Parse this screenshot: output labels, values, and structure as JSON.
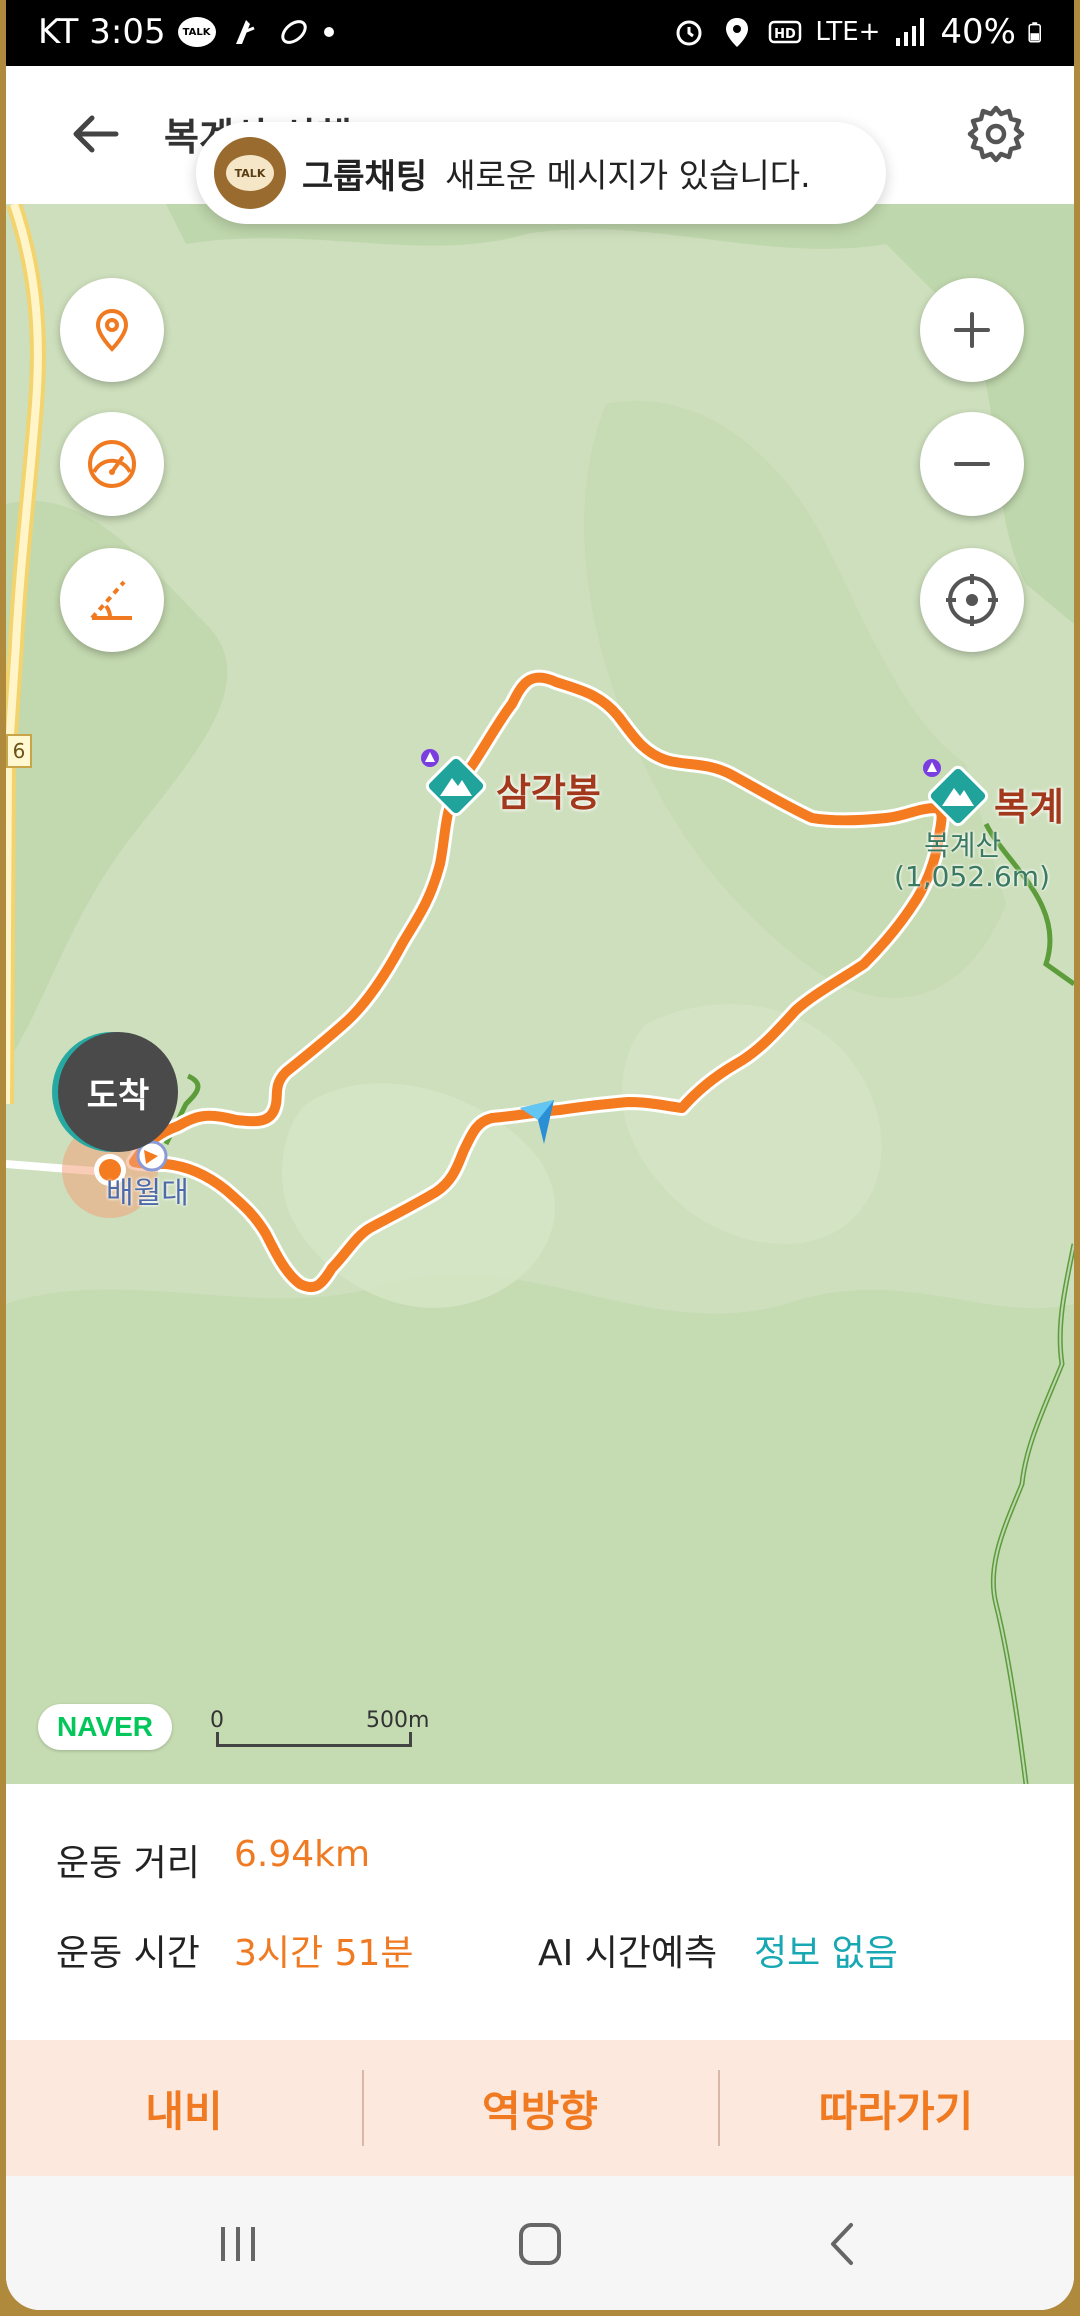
{
  "status_bar": {
    "carrier_time": "KT 3:05",
    "talk_icon_text": "TALK",
    "network": "LTE+",
    "battery": "40%"
  },
  "header": {
    "title": "복계산 산행",
    "back_icon": "arrow-left-icon",
    "settings_icon": "gear-icon"
  },
  "toast": {
    "icon_text": "TALK",
    "title": "그룹채팅",
    "message": "새로운 메시지가 있습니다."
  },
  "map": {
    "peaks": [
      {
        "name": "삼각봉"
      },
      {
        "name": "복계",
        "sub": "복계산",
        "elevation": "(1,052.6m)"
      }
    ],
    "arrive_badge": "도착",
    "start_label": "배월대",
    "road_number": "6",
    "logo": "NAVER",
    "scale_start": "0",
    "scale_end": "500m",
    "controls": {
      "left": [
        "location-pin-icon",
        "speedometer-icon",
        "slope-icon"
      ],
      "right": [
        "zoom-in-icon",
        "zoom-out-icon",
        "crosshair-icon"
      ]
    },
    "colors": {
      "route": "#f47b20",
      "terrain": "#cfe0bf",
      "peak": "#1fa39a"
    }
  },
  "stats": {
    "distance_label": "운동 거리",
    "distance_value": "6.94km",
    "time_label": "운동 시간",
    "time_value": "3시간 51분",
    "ai_label": "AI 시간예측",
    "ai_value": "정보 없음"
  },
  "actions": {
    "navi": "내비",
    "reverse": "역방향",
    "follow": "따라가기"
  },
  "system_nav": {
    "recent_icon": "recent-apps-icon",
    "home_icon": "home-icon",
    "back_icon": "back-chevron-icon"
  }
}
